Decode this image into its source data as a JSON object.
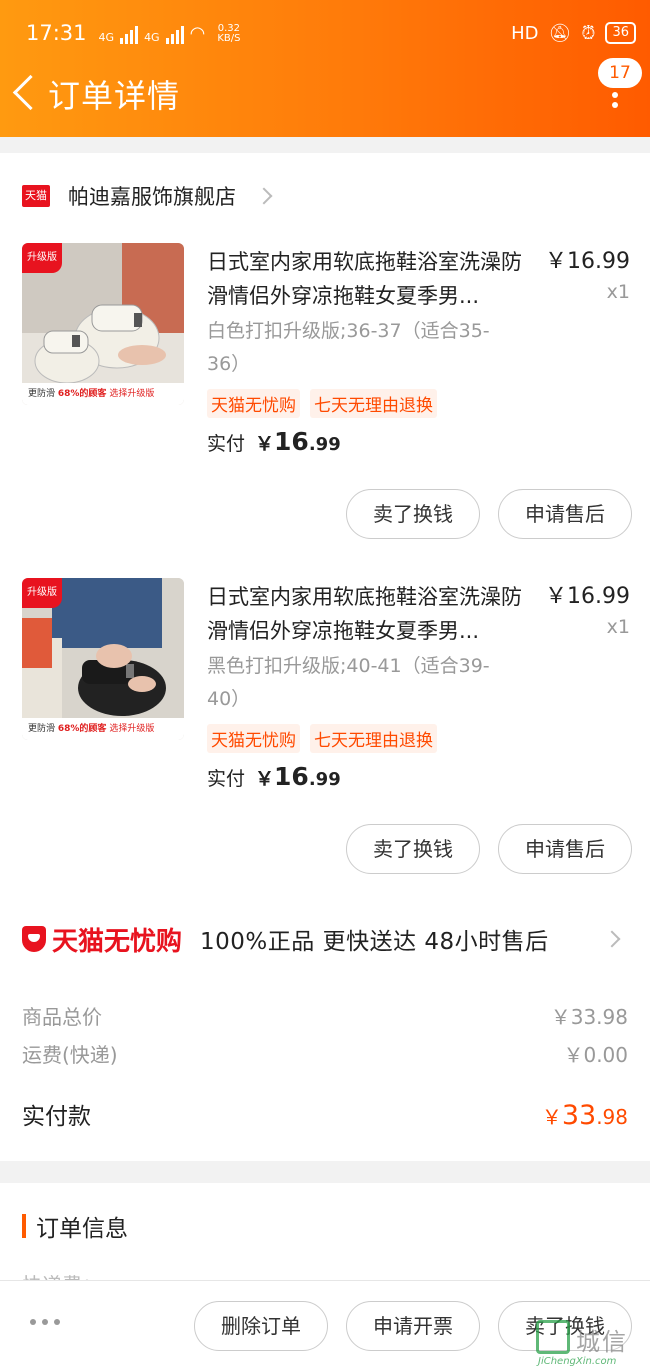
{
  "status_bar": {
    "time": "17:31",
    "network_a": "4G",
    "network_b": "4G",
    "speed_value": "0.32",
    "speed_unit": "KB/S",
    "hd": "HD",
    "battery": "36"
  },
  "header": {
    "title": "订单详情",
    "badge_count": "17"
  },
  "shop": {
    "logo_text": "天猫",
    "name": "帕迪嘉服饰旗舰店"
  },
  "items": [
    {
      "ribbon": "升级版",
      "promo_a": "更防滑",
      "promo_b": "68%的顾客",
      "promo_c": "选择升级版",
      "name": "日式室内家用软底拖鞋浴室洗澡防滑情侣外穿凉拖鞋女夏季男...",
      "price": "￥16.99",
      "qty": "x1",
      "sku": "白色打扣升级版;36-37（适合35-36）",
      "tags": [
        "天猫无忧购",
        "七天无理由退换"
      ],
      "paid_label": "实付",
      "paid_currency": "￥",
      "paid_int": "16",
      "paid_dec": ".99",
      "btn_sell": "卖了换钱",
      "btn_aftersale": "申请售后"
    },
    {
      "ribbon": "升级版",
      "promo_a": "更防滑",
      "promo_b": "68%的顾客",
      "promo_c": "选择升级版",
      "name": "日式室内家用软底拖鞋浴室洗澡防滑情侣外穿凉拖鞋女夏季男...",
      "price": "￥16.99",
      "qty": "x1",
      "sku": "黑色打扣升级版;40-41（适合39-40）",
      "tags": [
        "天猫无忧购",
        "七天无理由退换"
      ],
      "paid_label": "实付",
      "paid_currency": "￥",
      "paid_int": "16",
      "paid_dec": ".99",
      "btn_sell": "卖了换钱",
      "btn_aftersale": "申请售后"
    }
  ],
  "assurance": {
    "brand": "天猫无忧购",
    "text": "100%正品  更快送达  48小时售后"
  },
  "summary": {
    "goods_label": "商品总价",
    "goods_value": "￥33.98",
    "shipping_label": "运费(快递)",
    "shipping_value": "￥0.00",
    "total_label": "实付款",
    "total_currency": "￥",
    "total_int": "33",
    "total_dec": ".98"
  },
  "order_info": {
    "title": "订单信息",
    "peek": "快递费：..."
  },
  "bottom": {
    "delete": "删除订单",
    "invoice": "申请开票",
    "sell": "卖了换钱"
  },
  "watermark": {
    "text": "城信",
    "url": "JiChengXin.com"
  }
}
